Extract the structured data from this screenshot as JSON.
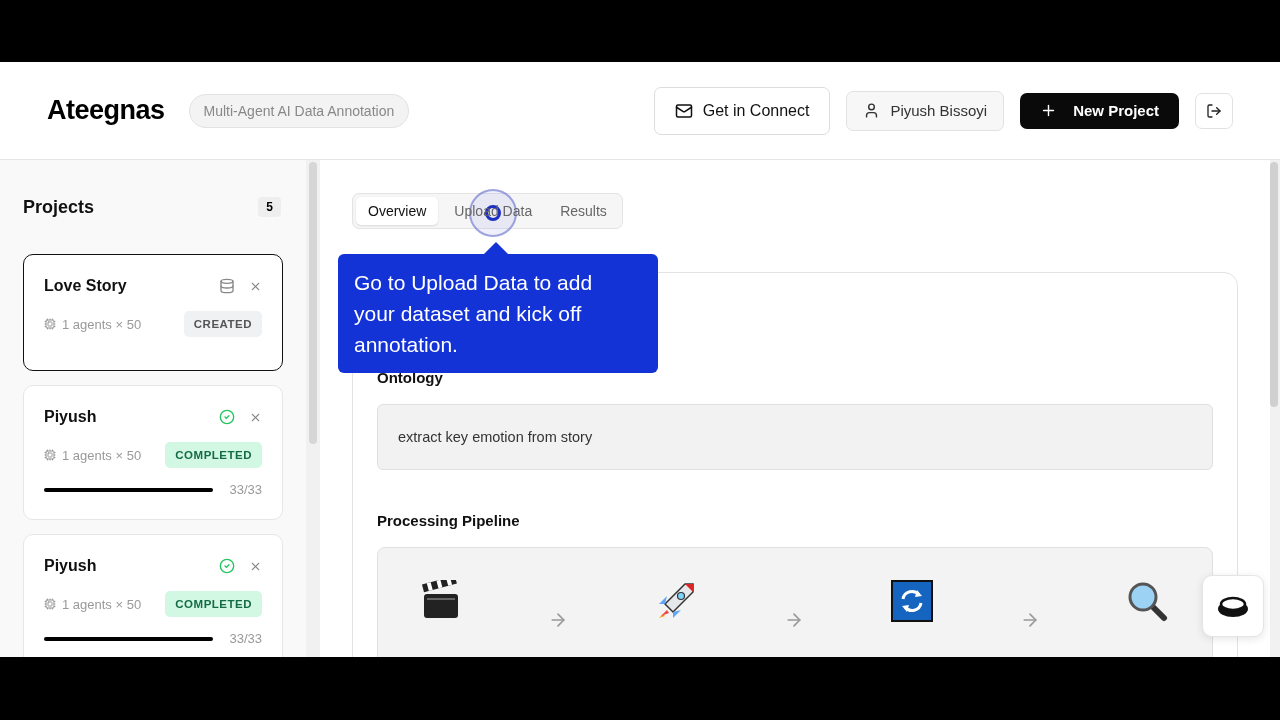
{
  "header": {
    "logo": "Ateegnas",
    "tagline": "Multi-Agent AI Data Annotation",
    "contact_button": "Get in Connect",
    "user": "Piyush Bissoyi",
    "new_project_button": "New Project"
  },
  "sidebar": {
    "title": "Projects",
    "count": "5",
    "projects": [
      {
        "name": "Love Story",
        "meta": "1 agents × 50",
        "status": "CREATED",
        "kind": "created",
        "selected": true
      },
      {
        "name": "Piyush",
        "meta": "1 agents × 50",
        "status": "COMPLETED",
        "kind": "completed",
        "selected": false,
        "level": 1,
        "progress": "33/33"
      },
      {
        "name": "Piyush",
        "meta": "1 agents × 50",
        "status": "COMPLETED",
        "kind": "completed",
        "selected": false,
        "level": 1,
        "progress": "33/33"
      }
    ]
  },
  "tabs": [
    {
      "label": "Overview",
      "selected": true
    },
    {
      "label": "Upload Data",
      "selected": false
    },
    {
      "label": "Results",
      "selected": false
    }
  ],
  "tooltip": "Go to Upload Data to add your dataset and kick off annotation.",
  "overview": {
    "ontology_title": "Ontology",
    "ontology": "extract key emotion from story",
    "pipeline_title": "Processing Pipeline",
    "steps": [
      {
        "kind": "clapper"
      },
      {
        "kind": "rocket"
      },
      {
        "kind": "cycle"
      },
      {
        "kind": "magnifier"
      }
    ]
  }
}
